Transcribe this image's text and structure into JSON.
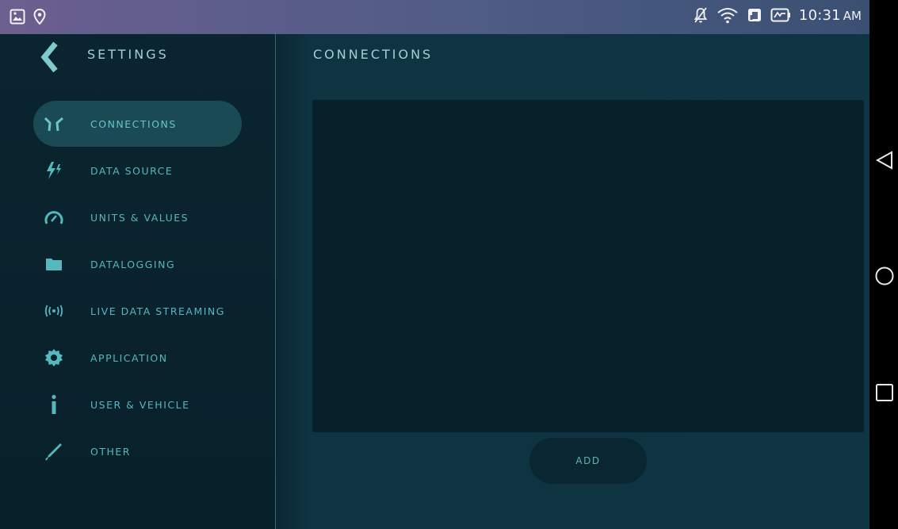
{
  "status_bar": {
    "time": "10:31",
    "ampm": "AM",
    "left_icons": [
      "gallery-icon",
      "location-icon"
    ],
    "right_icons": [
      "mute-icon",
      "wifi-icon",
      "sim-icon",
      "battery-charging-icon"
    ]
  },
  "sidebar": {
    "title": "SETTINGS",
    "items": [
      {
        "label": "CONNECTIONS",
        "icon": "connections-icon",
        "active": true
      },
      {
        "label": "DATA SOURCE",
        "icon": "lightning-icon",
        "active": false
      },
      {
        "label": "UNITS & VALUES",
        "icon": "gauge-icon",
        "active": false
      },
      {
        "label": "DATALOGGING",
        "icon": "folder-icon",
        "active": false
      },
      {
        "label": "LIVE DATA STREAMING",
        "icon": "broadcast-icon",
        "active": false
      },
      {
        "label": "APPLICATION",
        "icon": "gear-icon",
        "active": false
      },
      {
        "label": "USER & VEHICLE",
        "icon": "info-icon",
        "active": false
      },
      {
        "label": "OTHER",
        "icon": "pen-icon",
        "active": false
      }
    ]
  },
  "main": {
    "title": "CONNECTIONS",
    "add_label": "ADD"
  },
  "android_nav": [
    "back-icon",
    "home-icon",
    "recents-icon"
  ],
  "colors": {
    "accent": "#57b7be",
    "title": "#9fd0d4",
    "sidebar_bg": "#08202a",
    "main_bg": "#0f3443",
    "active_pill": "#1a4a53"
  }
}
